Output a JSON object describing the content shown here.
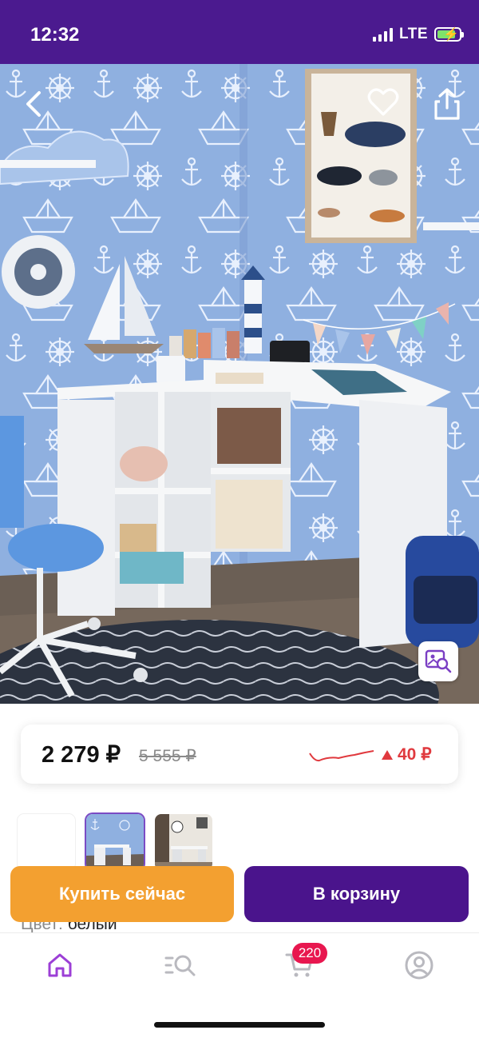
{
  "status_bar": {
    "time": "12:32",
    "network": "LTE",
    "signal_bars": 4,
    "battery_level": 0.85,
    "battery_charging": true,
    "background_color": "#4b1a8f"
  },
  "hero": {
    "icons": [
      "chevron-left-icon",
      "heart-icon",
      "share-icon",
      "image-search-icon"
    ],
    "wall_color": "#8fb0e0"
  },
  "price": {
    "current": "2 279 ₽",
    "old": "5 555 ₽",
    "delta": "40 ₽",
    "delta_color": "#e0393e"
  },
  "thumbnails": {
    "count": 3,
    "active_index": 1,
    "active_border_color": "#7b4bc4"
  },
  "color_option": {
    "label": "Цвет:",
    "value": "белый"
  },
  "actions": {
    "buy_now": "Купить сейчас",
    "add_to_cart": "В корзину",
    "buy_now_color": "#f3a030",
    "add_to_cart_color": "#4a148c"
  },
  "bottom_nav": {
    "icons": [
      "home-icon",
      "catalog-search-icon",
      "cart-icon",
      "profile-icon"
    ],
    "active": "home",
    "active_color": "#9c3fd6",
    "cart_badge": "220",
    "cart_badge_color": "#e8174f"
  }
}
